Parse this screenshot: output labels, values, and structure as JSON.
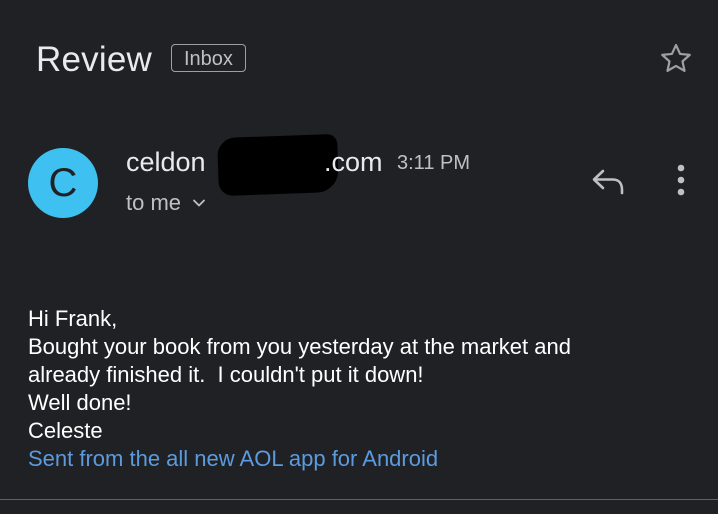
{
  "header": {
    "subject": "Review",
    "label": "Inbox",
    "star_icon": "star-outline-icon"
  },
  "message": {
    "avatar_letter": "C",
    "avatar_color": "#3ec0f0",
    "sender_local": "celdon",
    "sender_domain": ".com",
    "time": "3:11 PM",
    "recipient": "to me",
    "actions": {
      "reply_icon": "reply-icon",
      "more_icon": "more-vert-icon"
    },
    "body_lines": [
      "Hi Frank,",
      "Bought your book from you yesterday at the market and",
      "already finished it.  I couldn't put it down!",
      "Well done!",
      "Celeste"
    ],
    "signature_link": "Sent from the all new AOL app for Android"
  },
  "colors": {
    "background": "#202124",
    "text": "#e8eaed",
    "link": "#5b9bdf"
  }
}
